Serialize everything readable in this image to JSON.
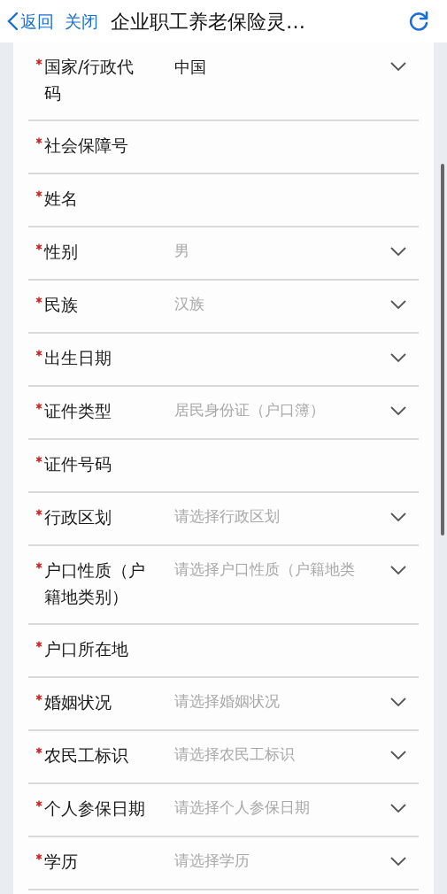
{
  "header": {
    "back": "返回",
    "close": "关闭",
    "title": "企业职工养老保险灵…"
  },
  "fields": [
    {
      "label": "国家/行政代码",
      "required": true,
      "kind": "select",
      "value": "中国"
    },
    {
      "label": "社会保障号",
      "required": true,
      "kind": "input"
    },
    {
      "label": "姓名",
      "required": true,
      "kind": "input"
    },
    {
      "label": "性别",
      "required": true,
      "kind": "select",
      "placeholder": "男"
    },
    {
      "label": "民族",
      "required": true,
      "kind": "select",
      "placeholder": "汉族"
    },
    {
      "label": "出生日期",
      "required": true,
      "kind": "select"
    },
    {
      "label": "证件类型",
      "required": true,
      "kind": "select",
      "placeholder": "居民身份证（户口簿）"
    },
    {
      "label": "证件号码",
      "required": true,
      "kind": "input"
    },
    {
      "label": "行政区划",
      "required": true,
      "kind": "select",
      "placeholder": "请选择行政区划"
    },
    {
      "label": "户口性质（户籍地类别）",
      "required": true,
      "kind": "select",
      "placeholder": "请选择户口性质（户籍地类"
    },
    {
      "label": "户口所在地",
      "required": true,
      "kind": "input"
    },
    {
      "label": "婚姻状况",
      "required": true,
      "kind": "select",
      "placeholder": "请选择婚姻状况"
    },
    {
      "label": "农民工标识",
      "required": true,
      "kind": "select",
      "placeholder": "请选择农民工标识"
    },
    {
      "label": "个人参保日期",
      "required": true,
      "kind": "select",
      "placeholder": "请选择个人参保日期"
    },
    {
      "label": "学历",
      "required": true,
      "kind": "select",
      "placeholder": "请选择学历"
    }
  ]
}
